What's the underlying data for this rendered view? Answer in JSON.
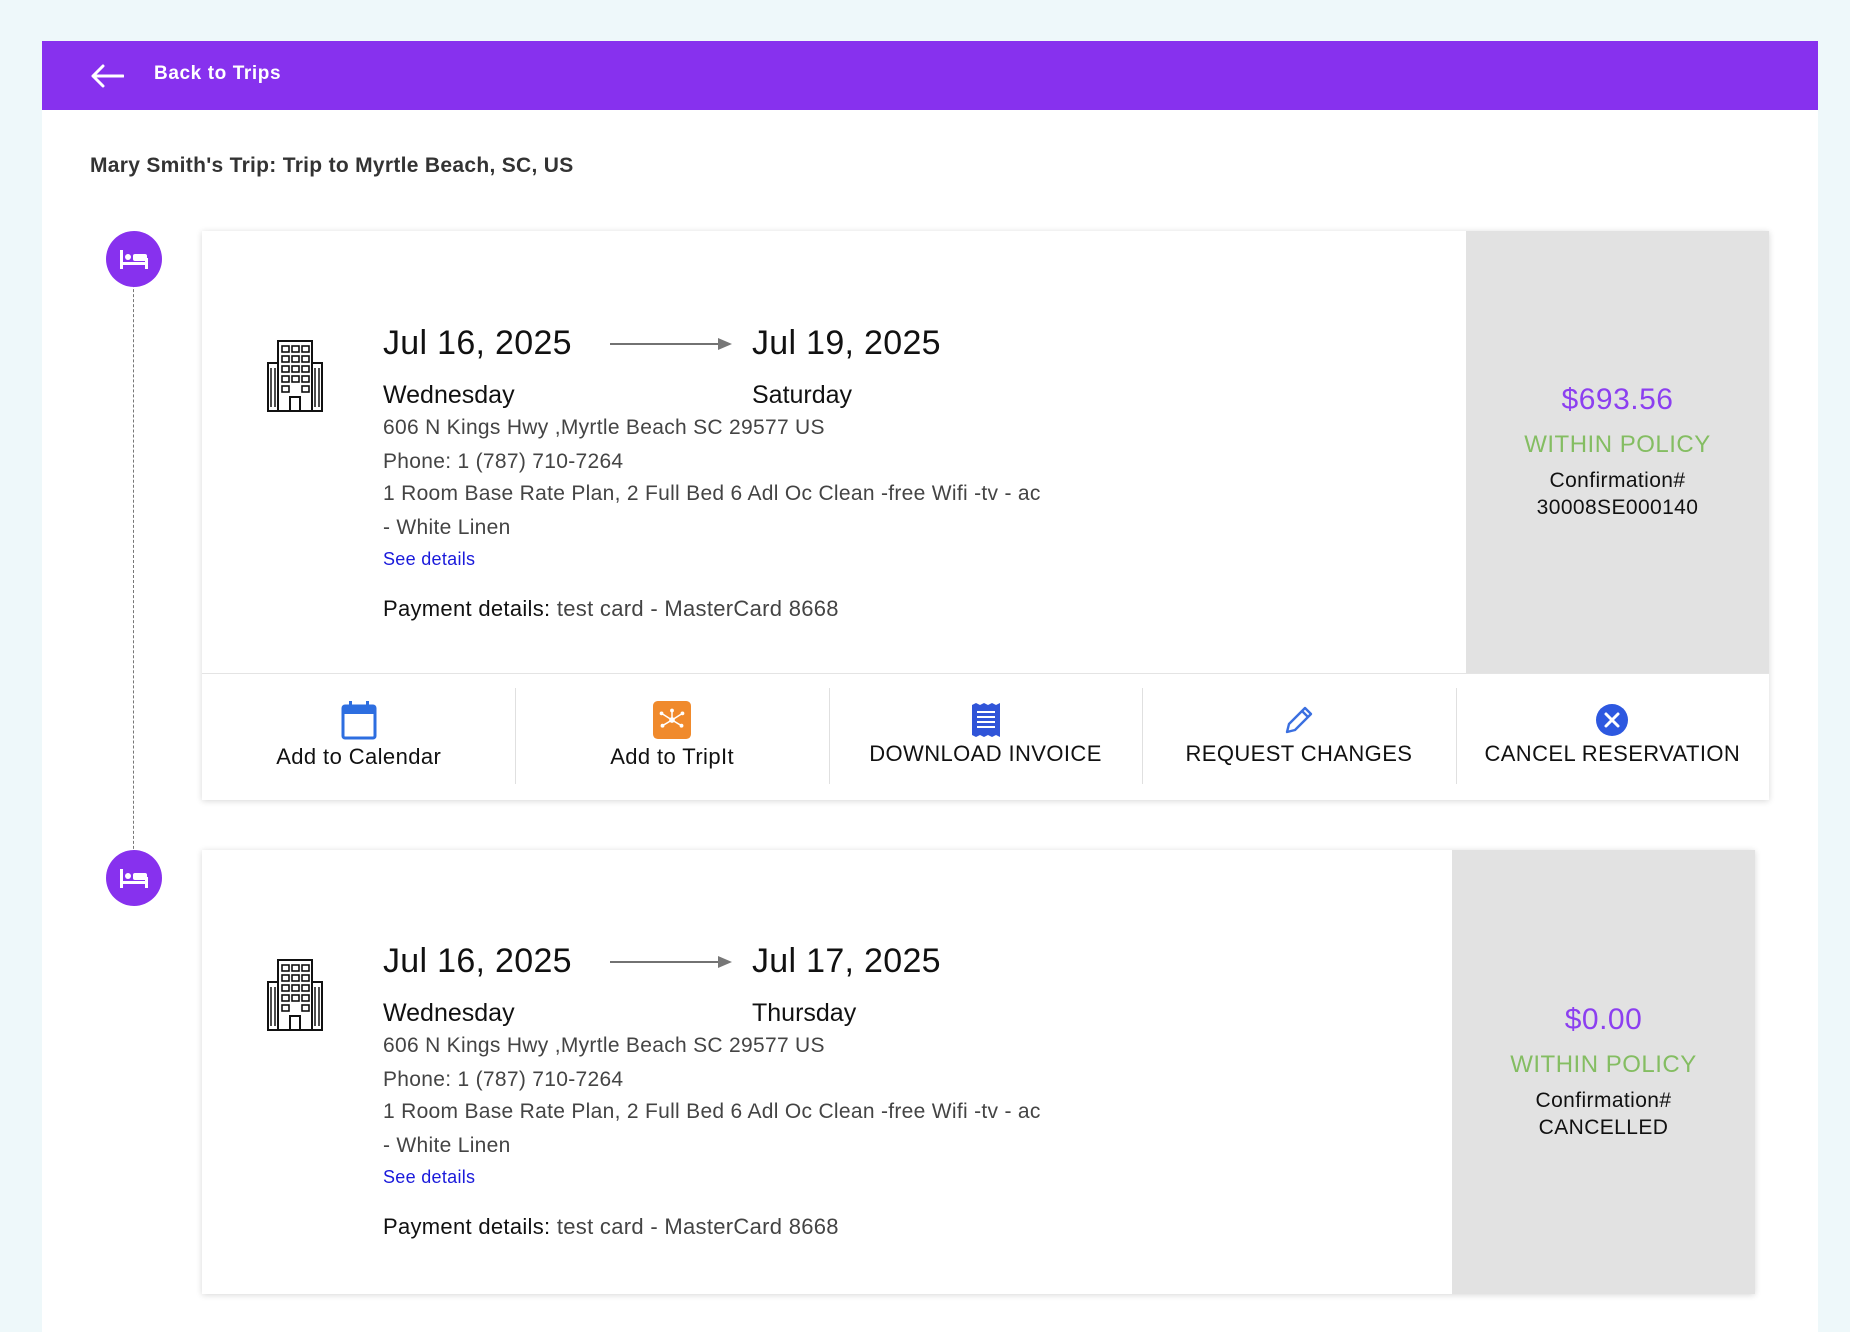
{
  "header": {
    "back_label": "Back to Trips",
    "bar_color": "#8731ee"
  },
  "trip_title": "Mary Smith's Trip: Trip to Myrtle Beach, SC, US",
  "reservations": [
    {
      "type_icon": "bed-icon",
      "check_in_date": "Jul 16, 2025",
      "check_in_day": "Wednesday",
      "check_out_date": "Jul 19, 2025",
      "check_out_day": "Saturday",
      "address": "606 N Kings Hwy ,Myrtle Beach SC 29577 US",
      "phone": "Phone: 1 (787) 710-7264",
      "room": "1 Room Base Rate Plan, 2 Full Bed 6 Adl Oc Clean -free Wifi -tv - ac - White Linen",
      "see_details": "See details",
      "payment_label": "Payment details:",
      "payment_value": " test card - MasterCard 8668",
      "price": "$693.56",
      "policy": "WITHIN POLICY",
      "confirmation_label": "Confirmation#",
      "confirmation_value": "30008SE000140",
      "actions": [
        {
          "label": "Add to Calendar",
          "icon": "calendar-icon"
        },
        {
          "label": "Add to TripIt",
          "icon": "tripit-icon"
        },
        {
          "label": "DOWNLOAD INVOICE",
          "icon": "invoice-icon"
        },
        {
          "label": "REQUEST CHANGES",
          "icon": "pencil-icon"
        },
        {
          "label": "CANCEL RESERVATION",
          "icon": "close-circle-icon"
        }
      ]
    },
    {
      "type_icon": "bed-icon",
      "check_in_date": "Jul 16, 2025",
      "check_in_day": "Wednesday",
      "check_out_date": "Jul 17, 2025",
      "check_out_day": "Thursday",
      "address": "606 N Kings Hwy ,Myrtle Beach SC 29577 US",
      "phone": "Phone: 1 (787) 710-7264",
      "room": "1 Room Base Rate Plan, 2 Full Bed 6 Adl Oc Clean -free Wifi -tv - ac - White Linen",
      "see_details": "See details",
      "payment_label": "Payment details:",
      "payment_value": " test card - MasterCard 8668",
      "price": "$0.00",
      "policy": "WITHIN POLICY",
      "confirmation_label": "Confirmation#",
      "confirmation_value": "CANCELLED"
    }
  ],
  "colors": {
    "accent": "#8731ee",
    "price": "#8c3ff0",
    "policy_ok": "#84bd62",
    "link": "#1a1adb",
    "price_box_bg": "#e2e2e2"
  }
}
